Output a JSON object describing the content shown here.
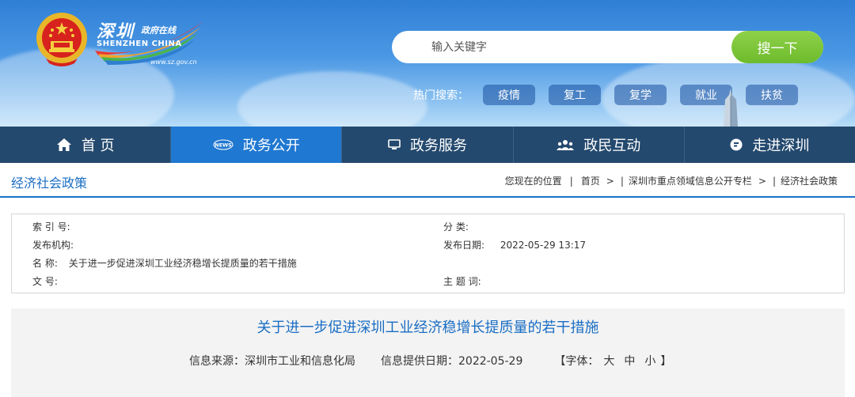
{
  "header": {
    "logo_cn": "深圳",
    "logo_cn_small": "政府在线",
    "logo_en": "SHENZHEN CHINA",
    "logo_url": "www.sz.gov.cn",
    "search": {
      "placeholder": "输入关键字",
      "button": "搜一下"
    },
    "hot_label": "热门搜索：",
    "hot_tags": [
      "疫情",
      "复工",
      "复学",
      "就业",
      "扶贫"
    ]
  },
  "nav": [
    {
      "label": "首 页",
      "icon": "home-icon"
    },
    {
      "label": "政务公开",
      "icon": "news-icon",
      "icon_text": "NEWS",
      "active": true
    },
    {
      "label": "政务服务",
      "icon": "monitor-icon"
    },
    {
      "label": "政民互动",
      "icon": "people-icon"
    },
    {
      "label": "走进深圳",
      "icon": "chat-icon"
    }
  ],
  "breadcrumb": {
    "section_title": "经济社会政策",
    "location_label": "您现在的位置",
    "items": [
      "首页",
      "深圳市重点领域信息公开专栏",
      "经济社会政策"
    ],
    "arrow": ">"
  },
  "info": {
    "index_label": "索 引 号:",
    "index_value": "",
    "category_label": "分 类:",
    "category_value": "",
    "publisher_label": "发布机构:",
    "publisher_value": "",
    "date_label": "发布日期:",
    "date_value": "2022-05-29 13:17",
    "name_label": "名 称:",
    "name_value": "关于进一步促进深圳工业经济稳增长提质量的若干措施",
    "doc_no_label": "文 号:",
    "doc_no_value": "",
    "subject_label": "主 题 词:",
    "subject_value": ""
  },
  "article": {
    "title": "关于进一步促进深圳工业经济稳增长提质量的若干措施",
    "source": "信息来源：深圳市工业和信息化局",
    "provided_date": "信息提供日期：2022-05-29",
    "font_label_open": "【字体：",
    "font_sizes": [
      "大",
      "中",
      "小"
    ],
    "font_label_close": "】"
  },
  "colors": {
    "nav_bg": "#24496e",
    "nav_active": "#1f78d1",
    "accent_blue": "#1a6ec4",
    "search_green": "#7cc43a"
  }
}
